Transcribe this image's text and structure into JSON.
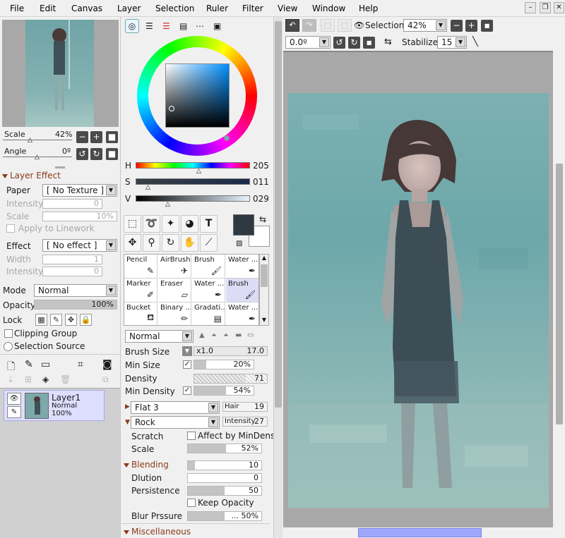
{
  "menu": [
    "File",
    "Edit",
    "Canvas",
    "Layer",
    "Selection",
    "Ruler",
    "Filter",
    "View",
    "Window",
    "Help"
  ],
  "navigator": {
    "scale_label": "Scale",
    "scale_value": "42%",
    "angle_label": "Angle",
    "angle_value": "0º"
  },
  "layer_effect": {
    "title": "Layer Effect",
    "paper_label": "Paper",
    "paper_value": "[ No Texture ]",
    "intensity_label": "Intensity",
    "intensity_value": "0",
    "scale_label": "Scale",
    "scale_value": "10%",
    "apply_label": "Apply to Linework",
    "effect_label": "Effect",
    "effect_value": "[ No effect ]",
    "width_label": "Width",
    "width_value": "1",
    "intensity2_label": "Intensity",
    "intensity2_value": "0"
  },
  "layer_props": {
    "mode_label": "Mode",
    "mode_value": "Normal",
    "opacity_label": "Opacity",
    "opacity_value": "100%",
    "opacity_fraction": 1.0,
    "lock_label": "Lock",
    "clipping_label": "Clipping Group",
    "selection_source_label": "Selection Source"
  },
  "layer": {
    "name": "Layer1",
    "mode": "Normal",
    "opacity": "100%"
  },
  "color": {
    "h_label": "H",
    "h_value": "205",
    "s_label": "S",
    "s_value": "011",
    "v_label": "V",
    "v_value": "029",
    "fg_color": "#2f3942",
    "bg_color": "#ffffff"
  },
  "brushes": [
    {
      "name": "Pencil",
      "icon": "pencil-icon"
    },
    {
      "name": "AirBrush",
      "icon": "airbrush-icon"
    },
    {
      "name": "Brush",
      "icon": "brush-icon"
    },
    {
      "name": "Water ...",
      "icon": "water-icon"
    },
    {
      "name": "Marker",
      "icon": "marker-icon"
    },
    {
      "name": "Eraser",
      "icon": "eraser-icon"
    },
    {
      "name": "Water ...",
      "icon": "water-icon"
    },
    {
      "name": "Brush",
      "icon": "brush-icon",
      "selected": true
    },
    {
      "name": "Bucket",
      "icon": "bucket-icon"
    },
    {
      "name": "Binary ...",
      "icon": "binary-icon"
    },
    {
      "name": "Gradati...",
      "icon": "gradation-icon"
    },
    {
      "name": "Water ...",
      "icon": "water-icon"
    }
  ],
  "brush_settings": {
    "mode_value": "Normal",
    "size_label": "Brush Size",
    "size_mult": "x1.0",
    "size_value": "17.0",
    "min_size_label": "Min Size",
    "min_size_value": "20%",
    "min_size_fraction": 0.2,
    "density_label": "Density",
    "density_value": "71",
    "density_fraction": 0.71,
    "min_density_label": "Min Density",
    "min_density_value": "54%",
    "min_density_fraction": 0.54,
    "shape_value": "Flat 3",
    "hair_label": "Hair",
    "hair_value": "19",
    "texture_value": "Rock",
    "intensity_label": "Intensity",
    "intensity_value": "27",
    "scratch_label": "Scratch",
    "affect_label": "Affect by MinDens",
    "scale_label": "Scale",
    "scale_value": "52%",
    "scale_fraction": 0.52,
    "blending_title": "Blending",
    "blending_value": "10",
    "blending_fraction": 0.1,
    "dilution_label": "Dlution",
    "dilution_value": "0",
    "dilution_fraction": 0.0,
    "persistence_label": "Persistence",
    "persistence_value": "50",
    "persistence_fraction": 0.5,
    "keep_opacity_label": "Keep Opacity",
    "blur_label": "Blur Prssure",
    "blur_value": "... 50%",
    "blur_fraction": 0.5,
    "misc_title": "Miscellaneous"
  },
  "canvas_toolbar": {
    "selection_label": "Selection",
    "zoom_value": "42%",
    "rotation_value": "0.0º",
    "stabilizer_label": "Stabilizer",
    "stabilizer_value": "15"
  }
}
